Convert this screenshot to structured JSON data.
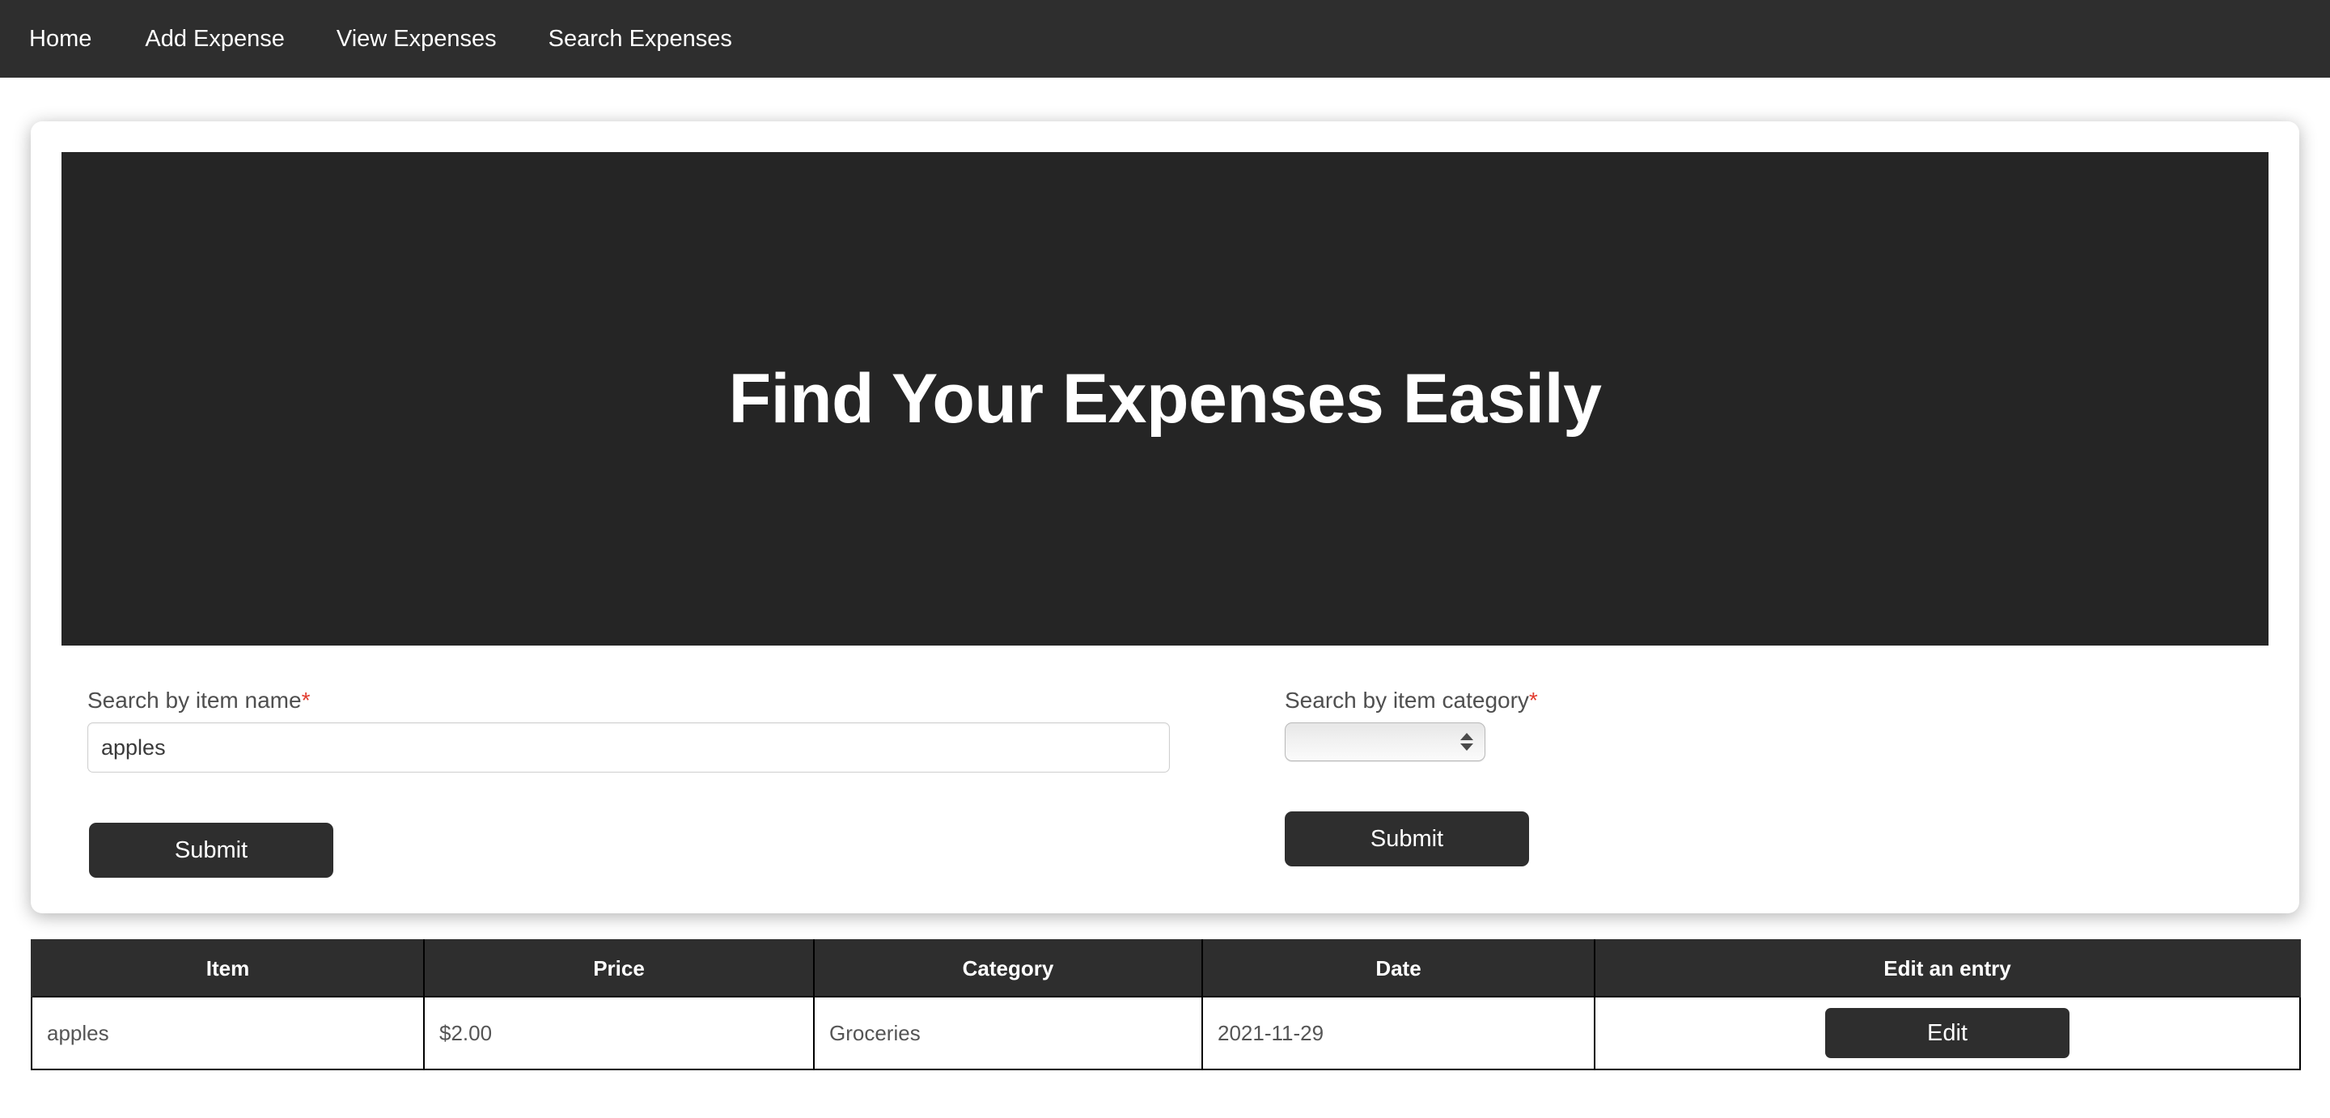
{
  "navbar": {
    "background": "#2e2e2e",
    "items": [
      {
        "label": "Home"
      },
      {
        "label": "Add Expense"
      },
      {
        "label": "View Expenses"
      },
      {
        "label": "Search Expenses"
      }
    ]
  },
  "hero": {
    "title": "Find Your Expenses Easily",
    "background": "#252525",
    "text_color": "#ffffff"
  },
  "search_by_name": {
    "label": "Search by item name",
    "required_marker": "*",
    "value": "apples",
    "placeholder": "",
    "submit_label": "Submit"
  },
  "search_by_category": {
    "label": "Search by item category",
    "required_marker": "*",
    "selected_value": "",
    "submit_label": "Submit"
  },
  "results_table": {
    "headers": [
      "Item",
      "Price",
      "Category",
      "Date",
      "Edit an entry"
    ],
    "rows": [
      {
        "item": "apples",
        "price": "$2.00",
        "category": "Groceries",
        "date": "2021-11-29",
        "action_label": "Edit"
      }
    ]
  },
  "colors": {
    "accent_dark": "#2e2e2e",
    "required_red": "#e23b2e",
    "page_background": "#ffffff",
    "table_border": "#000000"
  }
}
